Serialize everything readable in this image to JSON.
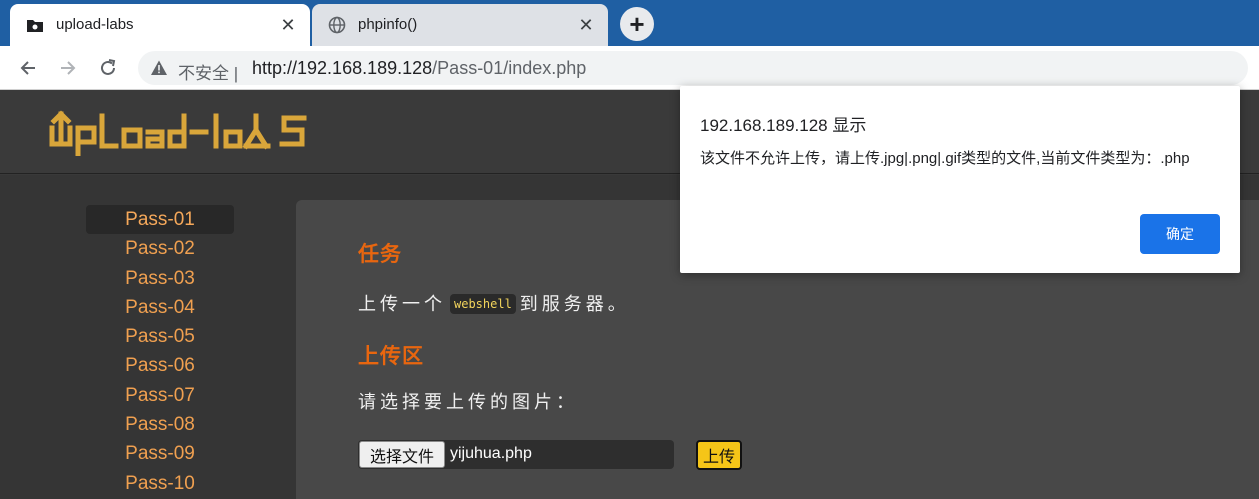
{
  "browser": {
    "tabs": [
      {
        "title": "upload-labs",
        "active": true
      },
      {
        "title": "phpinfo()",
        "active": false
      }
    ],
    "new_tab_label": "+",
    "security_label": "不安全",
    "url_host": "http://192.168.189.128",
    "url_path": "/Pass-01/index.php"
  },
  "site": {
    "logo_text": "UpLoad-labs",
    "accent_color": "#e8660f",
    "link_color": "#f0a050"
  },
  "sidebar": {
    "items": [
      "Pass-01",
      "Pass-02",
      "Pass-03",
      "Pass-04",
      "Pass-05",
      "Pass-06",
      "Pass-07",
      "Pass-08",
      "Pass-09",
      "Pass-10"
    ],
    "active_index": 0
  },
  "main": {
    "task_heading": "任务",
    "task_text_before": "上传一个",
    "task_code": "webshell",
    "task_text_after": "到服务器。",
    "upload_heading": "上传区",
    "upload_prompt": "请选择要上传的图片：",
    "file_button": "选择文件",
    "file_name": "yijuhua.php",
    "upload_button": "上传"
  },
  "alert": {
    "title": "192.168.189.128 显示",
    "message": "该文件不允许上传，请上传.jpg|.png|.gif类型的文件,当前文件类型为：.php",
    "ok_label": "确定",
    "ok_color": "#1a73e8"
  }
}
